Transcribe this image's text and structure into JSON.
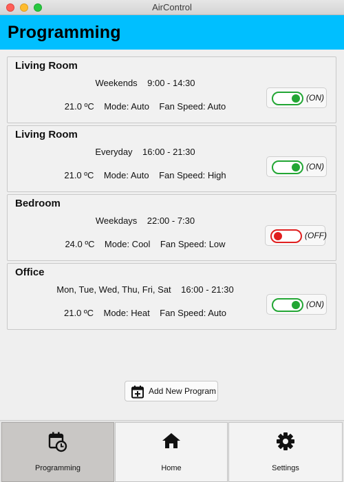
{
  "window": {
    "title": "AirControl"
  },
  "header": {
    "title": "Programming"
  },
  "programs": [
    {
      "room": "Living Room",
      "schedule": "Weekends    9:00 - 14:30",
      "settings": "21.0 ºC    Mode: Auto    Fan Speed: Auto",
      "enabled": true,
      "state_label": "(ON)"
    },
    {
      "room": "Living Room",
      "schedule": "Everyday    16:00 - 21:30",
      "settings": "21.0 ºC    Mode: Auto    Fan Speed: High",
      "enabled": true,
      "state_label": "(ON)"
    },
    {
      "room": "Bedroom",
      "schedule": "Weekdays    22:00 - 7:30",
      "settings": "24.0 ºC    Mode: Cool    Fan Speed: Low",
      "enabled": false,
      "state_label": "(OFF)"
    },
    {
      "room": "Office",
      "schedule": "Mon, Tue, Wed, Thu, Fri, Sat    16:00 - 21:30",
      "settings": "21.0 ºC    Mode: Heat    Fan Speed: Auto",
      "enabled": true,
      "state_label": "(ON)"
    }
  ],
  "add_button": {
    "label": "Add New Program",
    "icon": "calendar-plus-icon"
  },
  "navbar": {
    "items": [
      {
        "label": "Programming",
        "icon": "calendar-clock-icon",
        "active": true
      },
      {
        "label": "Home",
        "icon": "home-icon",
        "active": false
      },
      {
        "label": "Settings",
        "icon": "gear-icon",
        "active": false
      }
    ]
  },
  "colors": {
    "header": "#00bfff",
    "on": "#22a634",
    "off": "#e01e1e",
    "nav_active": "#c9c7c5"
  }
}
